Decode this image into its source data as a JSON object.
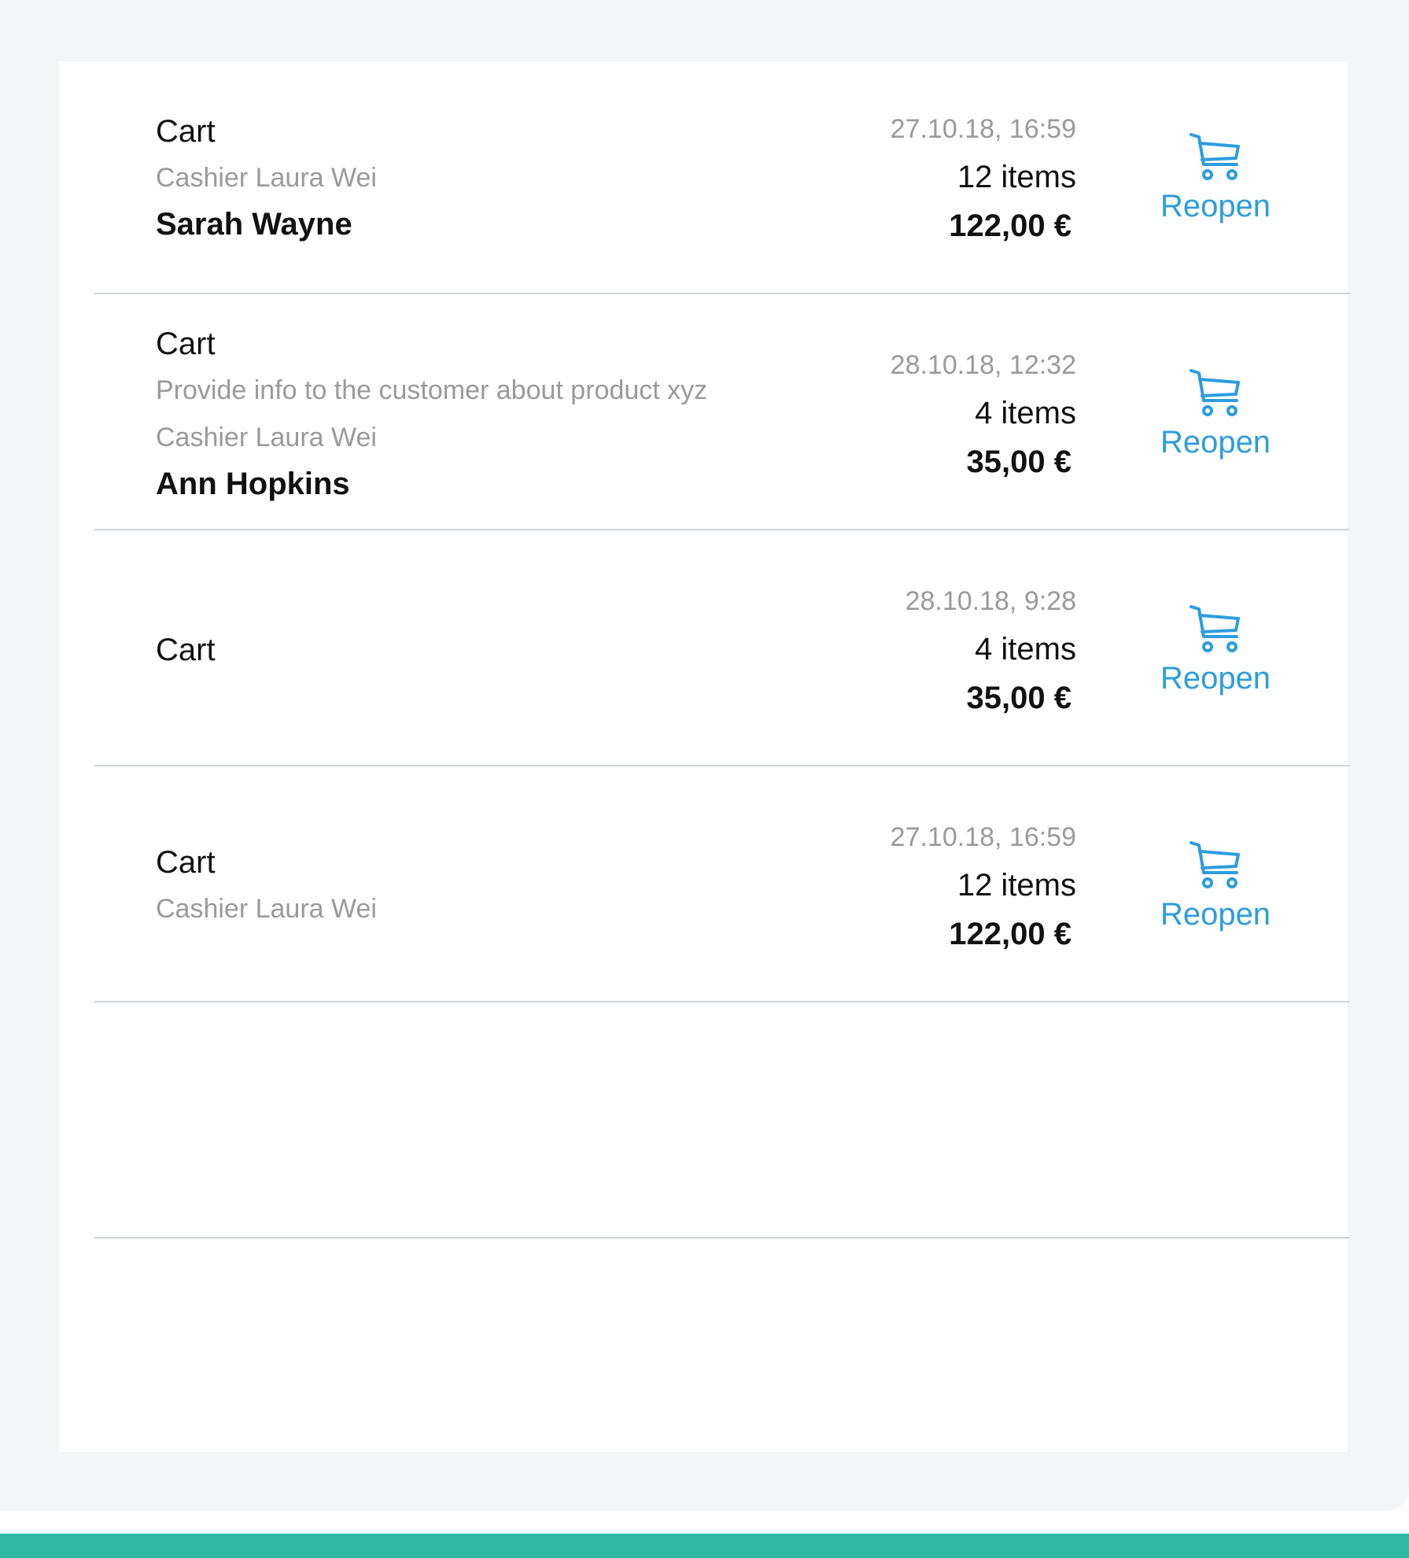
{
  "carts": [
    {
      "title": "Cart",
      "description": "",
      "cashier": "Cashier Laura Wei",
      "customer": "Sarah Wayne",
      "date": "27.10.18, 16:59",
      "items": "12 items",
      "total": "122,00 €",
      "action_label": "Reopen"
    },
    {
      "title": "Cart",
      "description": "Provide info to the customer about product xyz",
      "cashier": "Cashier Laura Wei",
      "customer": "Ann Hopkins",
      "date": "28.10.18, 12:32",
      "items": "4 items",
      "total": "35,00 €",
      "action_label": "Reopen"
    },
    {
      "title": "Cart",
      "description": "",
      "cashier": "",
      "customer": "",
      "date": "28.10.18, 9:28",
      "items": "4 items",
      "total": "35,00 €",
      "action_label": "Reopen"
    },
    {
      "title": "Cart",
      "description": "",
      "cashier": "Cashier Laura Wei",
      "customer": "",
      "date": "27.10.18, 16:59",
      "items": "12 items",
      "total": "122,00 €",
      "action_label": "Reopen"
    }
  ],
  "icons": {
    "reopen": "shopping-cart-icon"
  },
  "colors": {
    "accent": "#2d9de0",
    "footer": "#2fb8a4",
    "background": "#f4f5f7"
  }
}
